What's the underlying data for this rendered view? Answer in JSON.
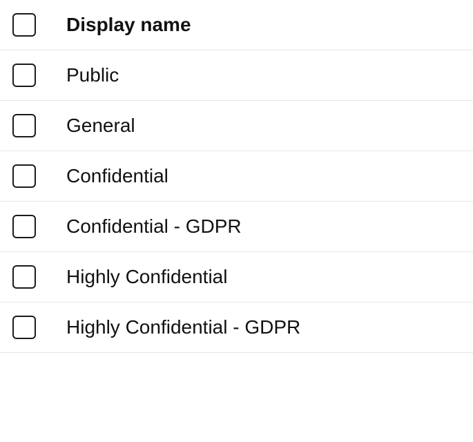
{
  "header": {
    "label": "Display name"
  },
  "items": [
    {
      "label": "Public"
    },
    {
      "label": "General"
    },
    {
      "label": "Confidential"
    },
    {
      "label": "Confidential - GDPR"
    },
    {
      "label": "Highly Confidential"
    },
    {
      "label": "Highly Confidential - GDPR"
    }
  ]
}
